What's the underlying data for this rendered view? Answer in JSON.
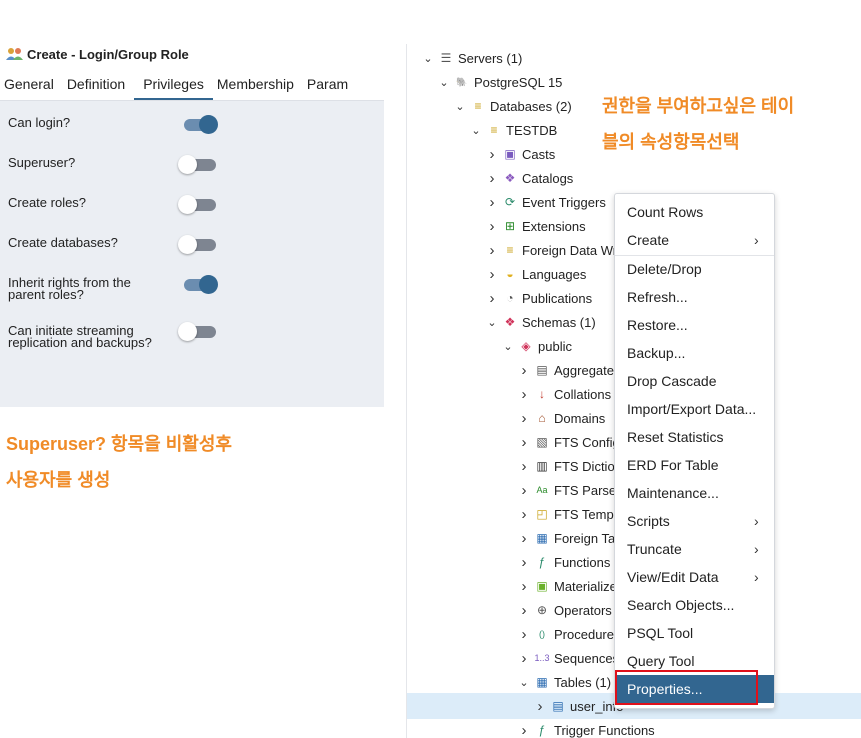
{
  "dialog": {
    "title": "Create - Login/Group Role",
    "tabs": [
      "General",
      "Definition",
      "Privileges",
      "Membership",
      "Param"
    ],
    "active_tab": "Privileges",
    "fields": [
      {
        "label": "Can login?",
        "enabled": true
      },
      {
        "label": "Superuser?",
        "enabled": false
      },
      {
        "label": "Create roles?",
        "enabled": false
      },
      {
        "label": "Create databases?",
        "enabled": false
      },
      {
        "label": "Inherit rights from the parent roles?",
        "enabled": true
      },
      {
        "label": "Can initiate streaming replication and backups?",
        "enabled": false
      }
    ]
  },
  "annotations": {
    "left_line1": "Superuser? 항목을 비활성후",
    "left_line2": "사용자를 생성",
    "right_line1": "권한을 부여하고싶은 테이",
    "right_line2": "블의 속성항목선택"
  },
  "tree": [
    {
      "label": "Servers (1)",
      "chev": "v",
      "icon": "server-icon"
    },
    {
      "label": "PostgreSQL 15",
      "chev": "v",
      "icon": "elephant-icon"
    },
    {
      "label": "Databases (2)",
      "chev": "v",
      "icon": "database-icon"
    },
    {
      "label": "TESTDB",
      "chev": "v",
      "icon": "database-icon"
    },
    {
      "label": "Casts",
      "chev": ">",
      "icon": "casts-icon"
    },
    {
      "label": "Catalogs",
      "chev": ">",
      "icon": "catalogs-icon"
    },
    {
      "label": "Event Triggers",
      "chev": ">",
      "icon": "event-trigger-icon"
    },
    {
      "label": "Extensions",
      "chev": ">",
      "icon": "extension-icon"
    },
    {
      "label": "Foreign Data Wra",
      "chev": ">",
      "icon": "foreign-data-icon"
    },
    {
      "label": "Languages",
      "chev": ">",
      "icon": "language-icon"
    },
    {
      "label": "Publications",
      "chev": ">",
      "icon": "publication-icon"
    },
    {
      "label": "Schemas (1)",
      "chev": "v",
      "icon": "schemas-icon"
    },
    {
      "label": "public",
      "chev": "v",
      "icon": "schema-icon"
    },
    {
      "label": "Aggregates",
      "chev": ">",
      "icon": "aggregate-icon"
    },
    {
      "label": "Collations",
      "chev": ">",
      "icon": "collation-icon"
    },
    {
      "label": "Domains",
      "chev": ">",
      "icon": "domain-icon"
    },
    {
      "label": "FTS Configu",
      "chev": ">",
      "icon": "fts-config-icon"
    },
    {
      "label": "FTS Diction",
      "chev": ">",
      "icon": "fts-dictionary-icon"
    },
    {
      "label": "FTS Parser",
      "chev": ">",
      "icon": "fts-parser-icon"
    },
    {
      "label": "FTS Templ",
      "chev": ">",
      "icon": "fts-template-icon"
    },
    {
      "label": "Foreign Tal",
      "chev": ">",
      "icon": "foreign-table-icon"
    },
    {
      "label": "Functions",
      "chev": ">",
      "icon": "function-icon"
    },
    {
      "label": "Materialize",
      "chev": ">",
      "icon": "materialized-view-icon"
    },
    {
      "label": "Operators",
      "chev": ">",
      "icon": "operator-icon"
    },
    {
      "label": "Procedures",
      "chev": ">",
      "icon": "procedure-icon"
    },
    {
      "label": "Sequences",
      "chev": ">",
      "icon": "sequence-icon"
    },
    {
      "label": "Tables (1)",
      "chev": "v",
      "icon": "tables-icon"
    },
    {
      "label": "user_info",
      "chev": ">",
      "icon": "table-icon"
    },
    {
      "label": "Trigger Functions",
      "chev": ">",
      "icon": "trigger-function-icon"
    }
  ],
  "context_menu": [
    {
      "label": "Count Rows",
      "submenu": false
    },
    {
      "label": "Create",
      "submenu": true
    },
    {
      "label": "Delete/Drop",
      "submenu": false
    },
    {
      "label": "Refresh...",
      "submenu": false
    },
    {
      "label": "Restore...",
      "submenu": false
    },
    {
      "label": "Backup...",
      "submenu": false
    },
    {
      "label": "Drop Cascade",
      "submenu": false
    },
    {
      "label": "Import/Export Data...",
      "submenu": false
    },
    {
      "label": "Reset Statistics",
      "submenu": false
    },
    {
      "label": "ERD For Table",
      "submenu": false
    },
    {
      "label": "Maintenance...",
      "submenu": false
    },
    {
      "label": "Scripts",
      "submenu": true
    },
    {
      "label": "Truncate",
      "submenu": true
    },
    {
      "label": "View/Edit Data",
      "submenu": true
    },
    {
      "label": "Search Objects...",
      "submenu": false
    },
    {
      "label": "PSQL Tool",
      "submenu": false
    },
    {
      "label": "Query Tool",
      "submenu": false
    },
    {
      "label": "Properties...",
      "submenu": false,
      "selected": true
    }
  ],
  "colors": {
    "accent": "#326690",
    "annotation": "#f08b27",
    "highlight": "#dcecf9",
    "redbox": "#e0101a"
  }
}
